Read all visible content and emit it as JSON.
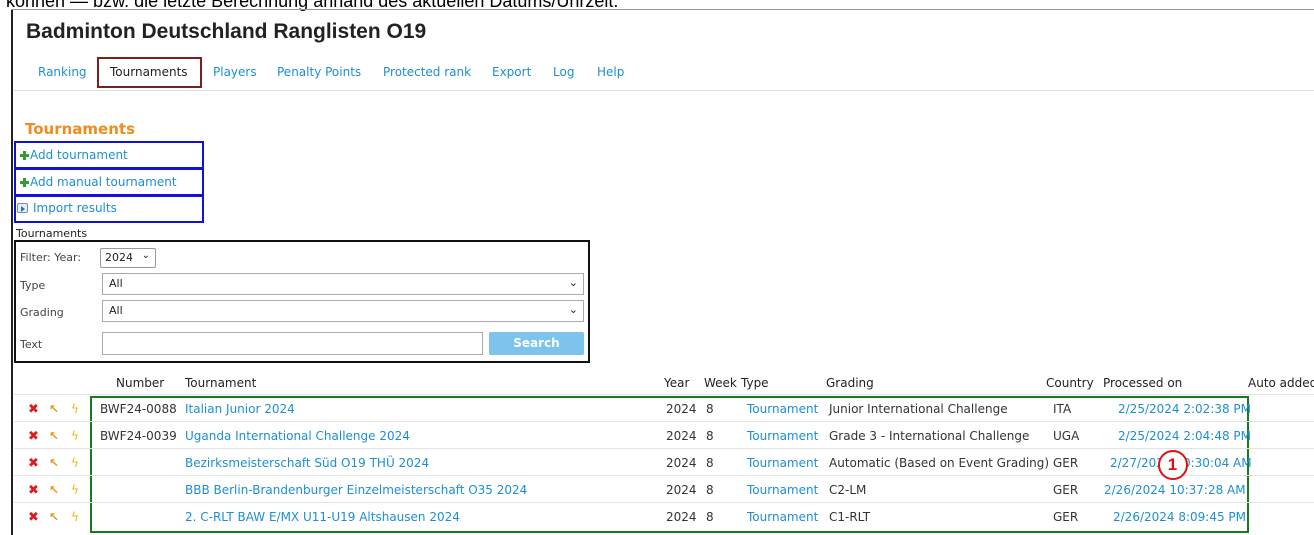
{
  "doc_top_text": "können — bzw. die letzte Berechnung anhand des aktuellen Datums/Uhrzeit.",
  "app_title": "Badminton Deutschland Ranglisten O19",
  "nav": {
    "ranking": "Ranking",
    "tournaments": "Tournaments",
    "players": "Players",
    "penalty_points": "Penalty Points",
    "protected_rank": "Protected rank",
    "export": "Export",
    "log": "Log",
    "help": "Help",
    "active": "Tournaments"
  },
  "section_title": "Tournaments",
  "actions": {
    "add_tournament": "Add tournament",
    "add_manual_tournament": "Add manual tournament",
    "import_results": "Import results"
  },
  "filter": {
    "title": "Tournaments",
    "year_label": "Filter: Year:",
    "year_value": "2024",
    "type_label": "Type",
    "type_value": "All",
    "grading_label": "Grading",
    "grading_value": "All",
    "text_label": "Text",
    "text_value": "",
    "search_label": "Search"
  },
  "table": {
    "headers": {
      "number": "Number",
      "tournament": "Tournament",
      "year": "Year",
      "week": "Week",
      "type": "Type",
      "grading": "Grading",
      "country": "Country",
      "processed_on": "Processed on",
      "auto_added": "Auto added"
    },
    "rows": [
      {
        "number": "BWF24-0088",
        "tournament": "Italian Junior 2024",
        "year": "2024",
        "week": "8",
        "type": "Tournament",
        "grading": "Junior International Challenge",
        "country": "ITA",
        "processed_on": "2/25/2024 2:02:38 PM"
      },
      {
        "number": "BWF24-0039",
        "tournament": "Uganda International Challenge 2024",
        "year": "2024",
        "week": "8",
        "type": "Tournament",
        "grading": "Grade 3 - International Challenge",
        "country": "UGA",
        "processed_on": "2/25/2024 2:04:48 PM"
      },
      {
        "number": "",
        "tournament": "Bezirksmeisterschaft Süd O19 THÜ 2024",
        "year": "2024",
        "week": "8",
        "type": "Tournament",
        "grading": "Automatic (Based on Event Grading)",
        "country": "GER",
        "processed_on": "2/27/2024 10:30:04 AM"
      },
      {
        "number": "",
        "tournament": "BBB Berlin-Brandenburger Einzelmeisterschaft O35 2024",
        "year": "2024",
        "week": "8",
        "type": "Tournament",
        "grading": "C2-LM",
        "country": "GER",
        "processed_on": "2/26/2024 10:37:28 AM"
      },
      {
        "number": "",
        "tournament": "2. C-RLT BAW E/MX U11-U19 Altshausen 2024",
        "year": "2024",
        "week": "8",
        "type": "Tournament",
        "grading": "C1-RLT",
        "country": "GER",
        "processed_on": "2/26/2024 8:09:45 PM"
      }
    ]
  },
  "marker": "1",
  "icons": [
    "plus-icon",
    "import-icon",
    "delete-icon",
    "edit-icon",
    "bolt-icon",
    "chevron-down-icon"
  ],
  "colors": {
    "link": "#1d8fd1",
    "section_title": "#f08c1d",
    "search_button": "#7cc4ee",
    "delete": "#e01b1b",
    "nav_highlight_box": "#7b1f1f",
    "action_highlight_box": "#1111dd",
    "table_highlight_box": "#1a7a1a",
    "marker": "#dd1111"
  }
}
